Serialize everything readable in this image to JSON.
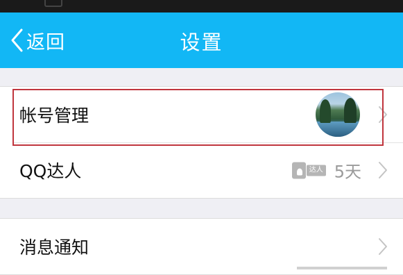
{
  "nav": {
    "back_label": "返回",
    "title": "设置"
  },
  "settings": {
    "items": [
      {
        "label": "帐号管理"
      },
      {
        "label": "QQ达人",
        "badge_tag": "达人",
        "days": "5天"
      },
      {
        "label": "消息通知"
      }
    ]
  },
  "icons": {
    "back": "chevron-left-icon",
    "disclosure": "chevron-right-icon",
    "talent": "qq-talent-icon"
  },
  "colors": {
    "nav_background": "#12b7f5",
    "highlight_border": "#c0353d",
    "page_background": "#efeff4"
  }
}
